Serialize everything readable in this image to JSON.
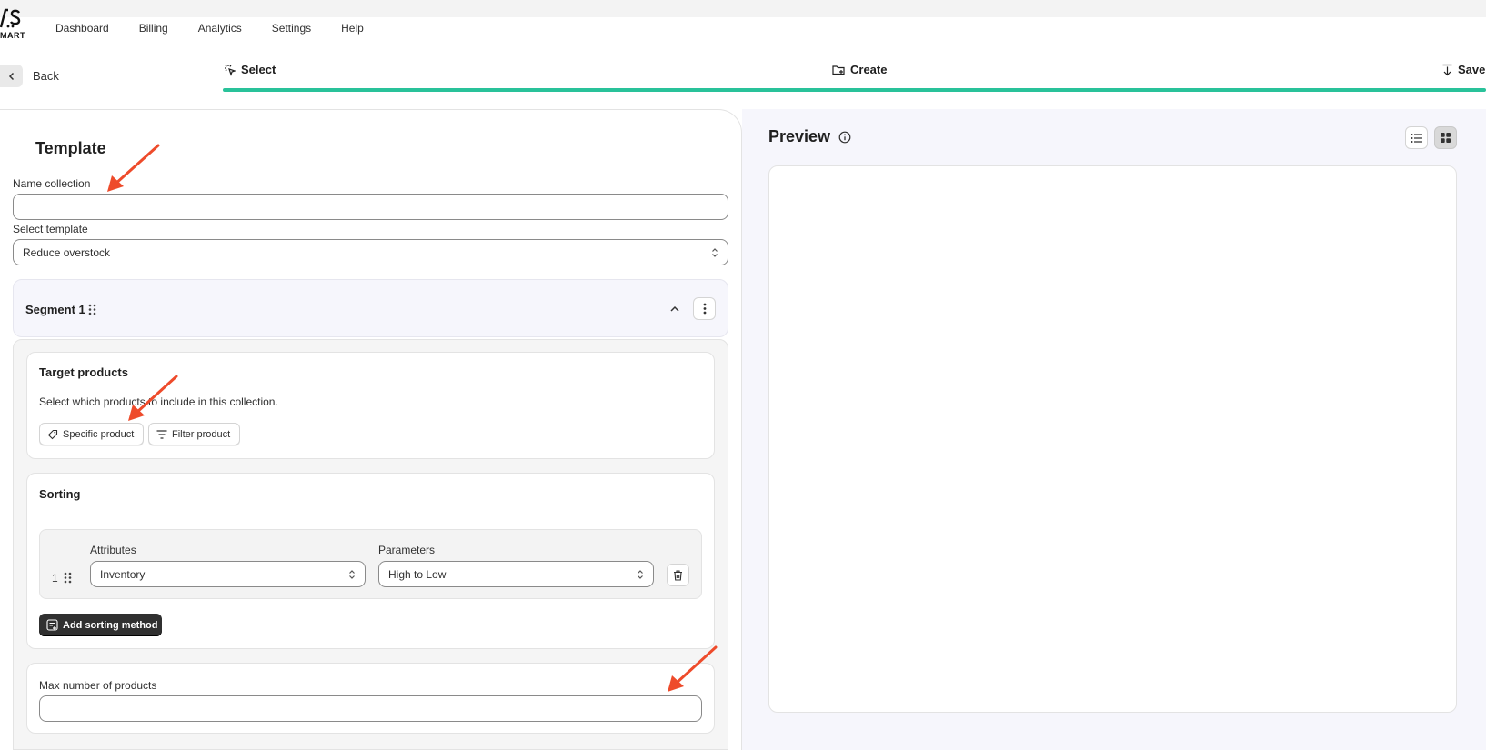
{
  "brand": {
    "logo_text": "MART"
  },
  "nav": {
    "items": [
      "Dashboard",
      "Billing",
      "Analytics",
      "Settings",
      "Help"
    ]
  },
  "back": {
    "label": "Back"
  },
  "steps": {
    "select": "Select",
    "create": "Create",
    "save": "Save"
  },
  "colors": {
    "progress": "#29c29a",
    "dark_button": "#303030",
    "annotation_arrow": "#ee4b2b"
  },
  "template": {
    "title": "Template",
    "name_label": "Name collection",
    "name_value": "",
    "select_label": "Select template",
    "select_value": "Reduce overstock"
  },
  "segment": {
    "title": "Segment 1",
    "target": {
      "title": "Target products",
      "description": "Select which products to include in this collection.",
      "specific_btn": "Specific product",
      "filter_btn": "Filter product"
    },
    "sorting": {
      "title": "Sorting",
      "attributes_label": "Attributes",
      "parameters_label": "Parameters",
      "rows": [
        {
          "index": "1",
          "attribute": "Inventory",
          "parameter": "High to Low"
        }
      ],
      "add_btn": "Add sorting method"
    },
    "max": {
      "label": "Max number of products",
      "value": ""
    }
  },
  "preview": {
    "title": "Preview"
  },
  "icons": [
    "chevron-left-icon",
    "select-cursor-icon",
    "folder-plus-icon",
    "download-icon",
    "chevron-updown-icon",
    "drag-handle-icon",
    "chevron-up-icon",
    "more-vertical-icon",
    "tag-icon",
    "filter-icon",
    "trash-icon",
    "add-list-icon",
    "info-icon",
    "list-view-icon",
    "grid-view-icon"
  ]
}
